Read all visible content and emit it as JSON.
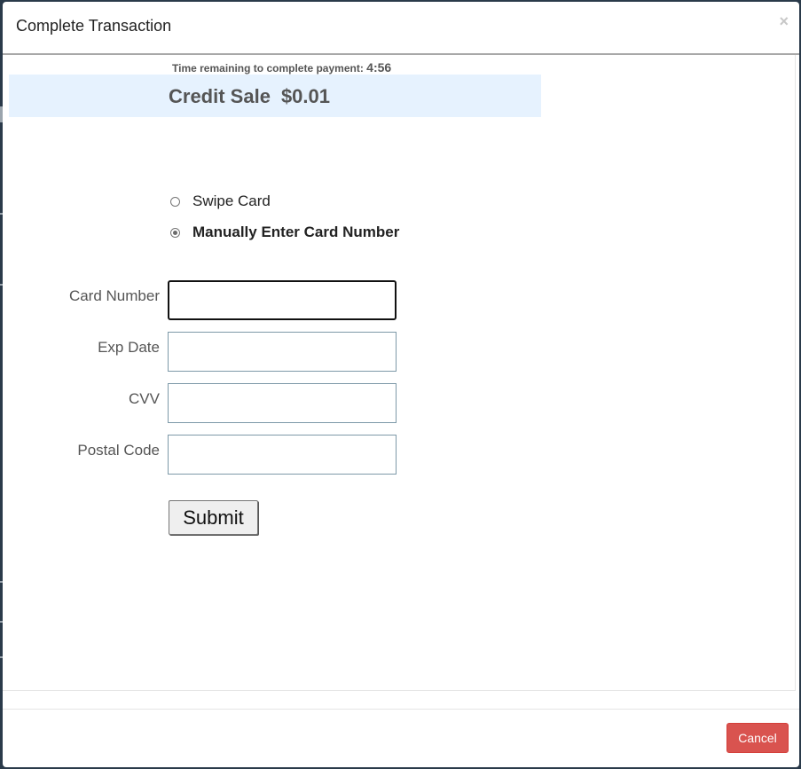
{
  "modal": {
    "title": "Complete Transaction",
    "close_label": "×"
  },
  "timer": {
    "label": "Time remaining to complete payment:",
    "value": "4:56"
  },
  "sale": {
    "type": "Credit Sale",
    "amount": "$0.01"
  },
  "payment_method": {
    "options": [
      {
        "label": "Swipe Card",
        "selected": false
      },
      {
        "label": "Manually Enter Card Number",
        "selected": true
      }
    ]
  },
  "form": {
    "card_number": {
      "label": "Card Number",
      "value": ""
    },
    "exp_date": {
      "label": "Exp Date",
      "value": ""
    },
    "cvv": {
      "label": "CVV",
      "value": ""
    },
    "postal_code": {
      "label": "Postal Code",
      "value": ""
    },
    "submit_label": "Submit"
  },
  "footer": {
    "cancel_label": "Cancel"
  },
  "colors": {
    "sale_band": "#e6f2fe",
    "cancel_button": "#d9534f",
    "input_border": "#7d99a8"
  }
}
